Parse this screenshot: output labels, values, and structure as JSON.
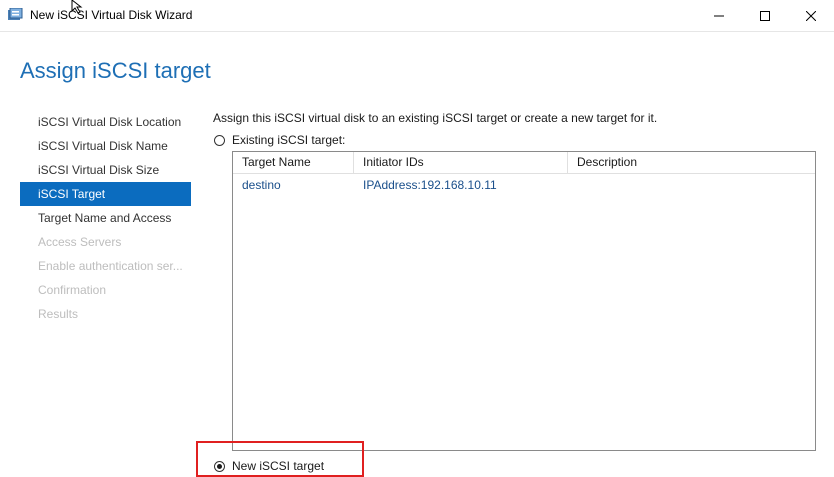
{
  "window": {
    "title": "New iSCSI Virtual Disk Wizard",
    "controls": {
      "minimize": "—",
      "maximize": "☐",
      "close": "✕"
    }
  },
  "page": {
    "title": "Assign iSCSI target"
  },
  "nav": {
    "items": [
      {
        "label": "iSCSI Virtual Disk Location",
        "state": "normal"
      },
      {
        "label": "iSCSI Virtual Disk Name",
        "state": "normal"
      },
      {
        "label": "iSCSI Virtual Disk Size",
        "state": "normal"
      },
      {
        "label": "iSCSI Target",
        "state": "active"
      },
      {
        "label": "Target Name and Access",
        "state": "normal"
      },
      {
        "label": "Access Servers",
        "state": "disabled"
      },
      {
        "label": "Enable authentication ser...",
        "state": "disabled"
      },
      {
        "label": "Confirmation",
        "state": "disabled"
      },
      {
        "label": "Results",
        "state": "disabled"
      }
    ]
  },
  "main": {
    "description": "Assign this iSCSI virtual disk to an existing iSCSI target or create a new target for it.",
    "existing_option": {
      "label": "Existing iSCSI target:",
      "selected": false
    },
    "new_option": {
      "label": "New iSCSI target",
      "selected": true
    },
    "table": {
      "columns": [
        "Target Name",
        "Initiator IDs",
        "Description"
      ],
      "rows": [
        [
          "destino",
          "IPAddress:192.168.10.11",
          ""
        ]
      ]
    }
  },
  "colors": {
    "accent": "#0b6cbf",
    "title": "#1e6fb5",
    "highlight": "#e02020"
  }
}
